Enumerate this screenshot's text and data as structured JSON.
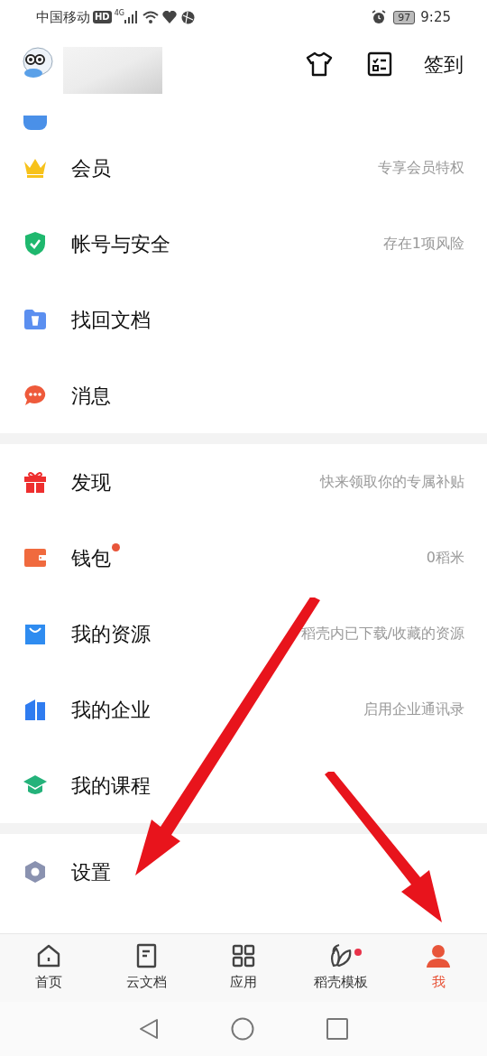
{
  "status_bar": {
    "carrier": "中国移动",
    "hd": "HD",
    "network": "4G",
    "battery": "97",
    "time": "9:25"
  },
  "header": {
    "sign_in": "签到"
  },
  "sections": [
    {
      "items": [
        {
          "label": "会员",
          "detail": "专享会员特权",
          "dot": false
        },
        {
          "label": "帐号与安全",
          "detail": "存在1项风险",
          "dot": false
        },
        {
          "label": "找回文档",
          "dot": false
        },
        {
          "label": "消息",
          "dot": false
        }
      ]
    },
    {
      "items": [
        {
          "label": "发现",
          "detail": "快来领取你的专属补贴",
          "dot": false
        },
        {
          "label": "钱包",
          "detail": "0稻米",
          "dot": true
        },
        {
          "label": "我的资源",
          "detail": "稻壳内已下载/收藏的资源",
          "dot": false
        },
        {
          "label": "我的企业",
          "detail": "启用企业通讯录",
          "dot": false
        },
        {
          "label": "我的课程",
          "dot": false
        }
      ]
    },
    {
      "items": [
        {
          "label": "设置",
          "dot": false
        }
      ]
    }
  ],
  "tabs": [
    {
      "label": "首页",
      "selected": false,
      "dot": false
    },
    {
      "label": "云文档",
      "selected": false,
      "dot": false
    },
    {
      "label": "应用",
      "selected": false,
      "dot": false
    },
    {
      "label": "稻壳模板",
      "selected": false,
      "dot": true
    },
    {
      "label": "我",
      "selected": true,
      "dot": false
    }
  ]
}
